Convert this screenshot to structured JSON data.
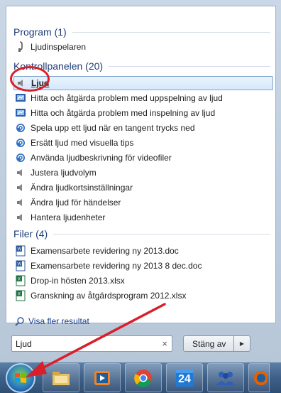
{
  "start_menu": {
    "groups": [
      {
        "title": "Program (1)",
        "items": [
          {
            "label": "Ljudinspelaren",
            "icon": "microphone-icon"
          }
        ]
      },
      {
        "title": "Kontrollpanelen (20)",
        "items": [
          {
            "label": "Ljud",
            "icon": "speaker-icon",
            "selected": true
          },
          {
            "label": "Hitta och åtgärda problem med uppspelning av ljud",
            "icon": "troubleshoot-icon"
          },
          {
            "label": "Hitta och åtgärda problem med inspelning av ljud",
            "icon": "troubleshoot-icon"
          },
          {
            "label": "Spela upp ett ljud när en tangent trycks ned",
            "icon": "ease-of-access-icon"
          },
          {
            "label": "Ersätt ljud med visuella tips",
            "icon": "ease-of-access-icon"
          },
          {
            "label": "Använda ljudbeskrivning för videofiler",
            "icon": "ease-of-access-icon"
          },
          {
            "label": "Justera ljudvolym",
            "icon": "speaker-icon"
          },
          {
            "label": "Ändra ljudkortsinställningar",
            "icon": "speaker-icon"
          },
          {
            "label": "Ändra ljud för händelser",
            "icon": "speaker-icon"
          },
          {
            "label": "Hantera ljudenheter",
            "icon": "speaker-icon"
          }
        ]
      },
      {
        "title": "Filer (4)",
        "items": [
          {
            "label": "Examensarbete revidering ny 2013.doc",
            "icon": "word-doc-icon"
          },
          {
            "label": "Examensarbete revidering ny 2013 8 dec.doc",
            "icon": "word-doc-icon"
          },
          {
            "label": "Drop-in hösten 2013.xlsx",
            "icon": "excel-icon"
          },
          {
            "label": "Granskning av åtgärdsprogram 2012.xlsx",
            "icon": "excel-icon"
          }
        ]
      }
    ],
    "more_results": "Visa fler resultat",
    "search": {
      "value": "Ljud",
      "clear": "×"
    },
    "shutdown": {
      "label": "Stäng av",
      "arrow": "▶"
    }
  },
  "taskbar": {
    "calendar_day": "24",
    "apps": [
      "start-orb",
      "file-explorer-icon",
      "media-player-icon",
      "chrome-icon",
      "calendar-icon",
      "people-icon",
      "firefox-icon"
    ]
  },
  "colors": {
    "annotation_red": "#d8202a",
    "group_title": "#1e3c78",
    "selection": "#d6e8fb"
  }
}
